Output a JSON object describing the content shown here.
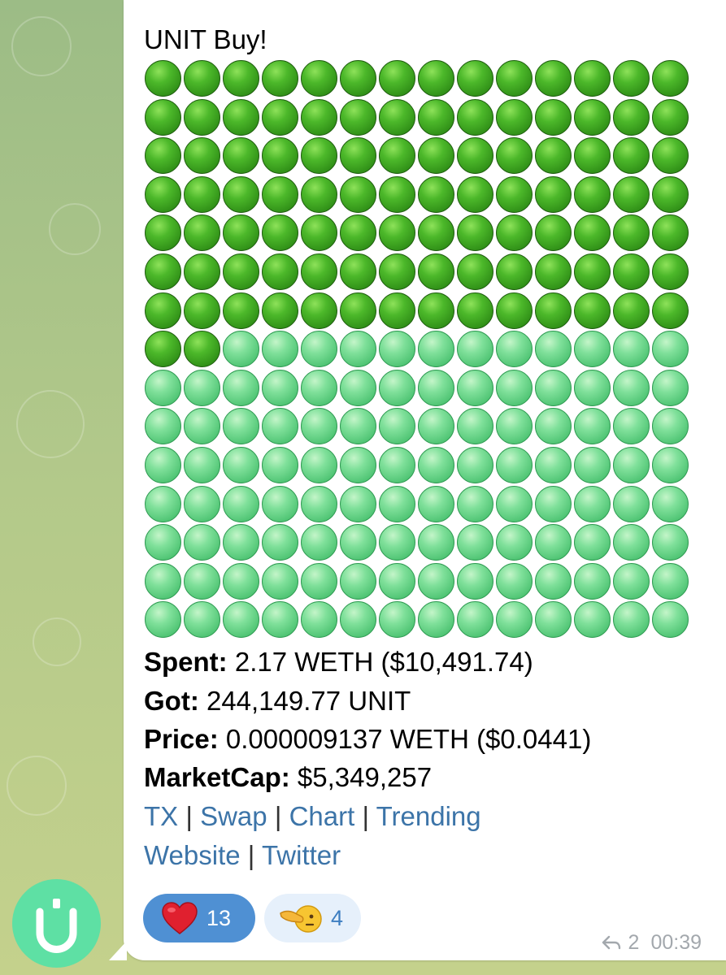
{
  "message": {
    "title": "UNIT Buy!",
    "progress": {
      "filled": 100,
      "total": 210,
      "columns": 14
    },
    "details": [
      {
        "label": "Spent:",
        "value": " 2.17 WETH ($10,491.74)"
      },
      {
        "label": "Got:",
        "value": " 244,149.77 UNIT"
      },
      {
        "label": "Price:",
        "value": " 0.000009137 WETH ($0.0441)"
      },
      {
        "label": "MarketCap:",
        "value": " $5,349,257"
      }
    ],
    "links_row1": [
      "TX",
      "Swap",
      "Chart",
      "Trending"
    ],
    "links_row2": [
      "Website",
      "Twitter"
    ],
    "separator": "|",
    "reactions": [
      {
        "icon": "heart-icon",
        "count": "13"
      },
      {
        "icon": "pointing-face-icon",
        "count": "4"
      }
    ],
    "forwards": "2",
    "time": "00:39"
  },
  "colors": {
    "dark_dot": "#3a9e1e",
    "light_dot": "#6fd58c",
    "link": "#3c74a8",
    "avatar": "#5ee0a4",
    "reaction_active": "#4f90d3"
  }
}
